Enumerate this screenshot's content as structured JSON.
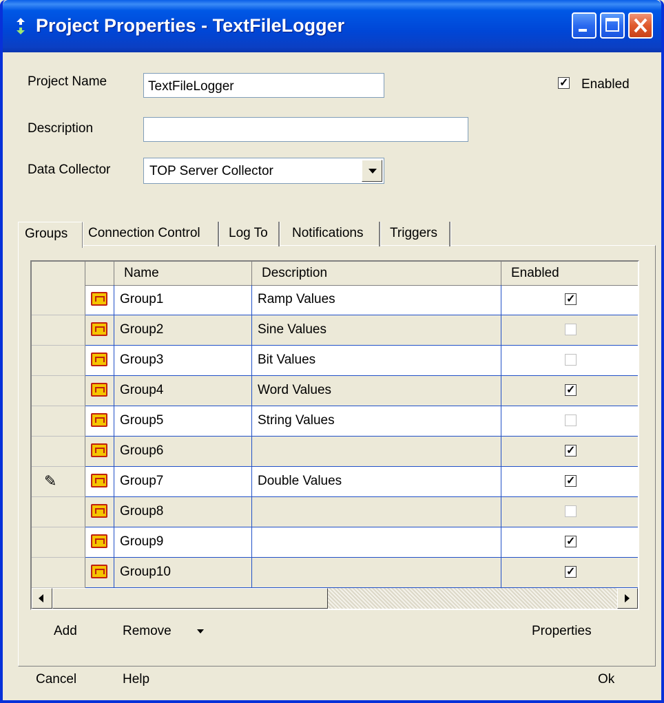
{
  "window": {
    "title": "Project Properties - TextFileLogger"
  },
  "form": {
    "project_name_label": "Project Name",
    "project_name_value": "TextFileLogger",
    "description_label": "Description",
    "description_value": "",
    "data_collector_label": "Data Collector",
    "data_collector_value": "TOP Server Collector",
    "enabled_label": "Enabled",
    "enabled_checked": true
  },
  "tabs": [
    {
      "label": "Groups",
      "active": true
    },
    {
      "label": "Connection Control",
      "active": false
    },
    {
      "label": "Log To",
      "active": false
    },
    {
      "label": "Notifications",
      "active": false
    },
    {
      "label": "Triggers",
      "active": false
    }
  ],
  "grid": {
    "columns": {
      "name": "Name",
      "description": "Description",
      "enabled": "Enabled"
    },
    "rows": [
      {
        "name": "Group1",
        "description": "Ramp Values",
        "enabled": true,
        "editing": false
      },
      {
        "name": "Group2",
        "description": "Sine Values",
        "enabled": false,
        "editing": false
      },
      {
        "name": "Group3",
        "description": "Bit Values",
        "enabled": false,
        "editing": false
      },
      {
        "name": "Group4",
        "description": "Word Values",
        "enabled": true,
        "editing": false
      },
      {
        "name": "Group5",
        "description": "String Values",
        "enabled": false,
        "editing": false
      },
      {
        "name": "Group6",
        "description": "",
        "enabled": true,
        "editing": false
      },
      {
        "name": "Group7",
        "description": "Double Values",
        "enabled": true,
        "editing": true
      },
      {
        "name": "Group8",
        "description": "",
        "enabled": false,
        "editing": false
      },
      {
        "name": "Group9",
        "description": "",
        "enabled": true,
        "editing": false
      },
      {
        "name": "Group10",
        "description": "",
        "enabled": true,
        "editing": false
      }
    ]
  },
  "grid_toolbar": {
    "add": "Add",
    "remove": "Remove",
    "properties": "Properties"
  },
  "footer": {
    "cancel": "Cancel",
    "help": "Help",
    "ok": "Ok"
  },
  "icons": {
    "row_icon": "folder-icon",
    "editing_marker": "pencil-icon"
  },
  "colors": {
    "titlebar": "#0046D6",
    "window_bg": "#ECE9D8",
    "grid_line": "#2050C8",
    "close_button": "#E05A2C"
  }
}
